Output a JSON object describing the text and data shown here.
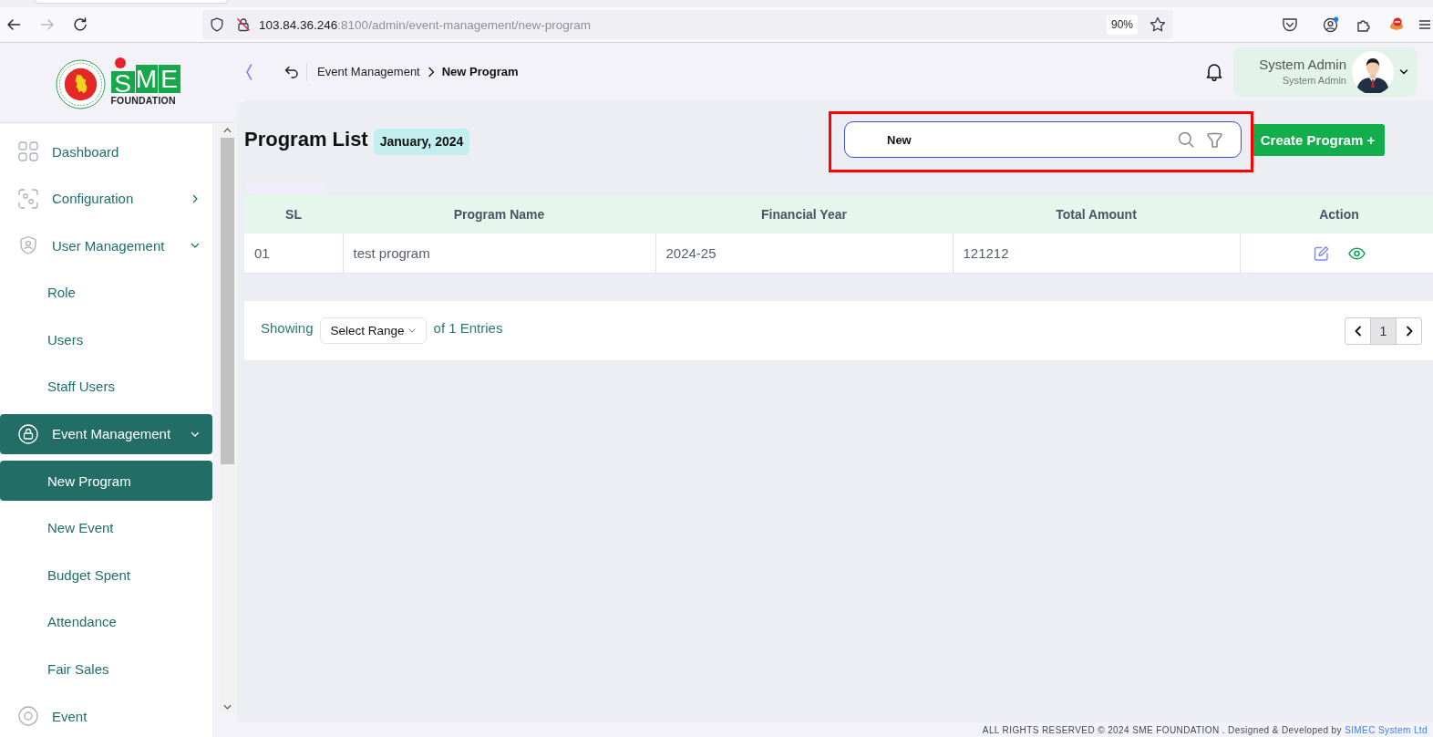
{
  "browser": {
    "back": {
      "disabled": false
    },
    "forward": {
      "disabled": true
    },
    "url": {
      "host": "103.84.36.246",
      "path": ":8100/admin/event-management/new-program"
    },
    "zoom": "90%"
  },
  "logo": {
    "letters": [
      "S",
      "M",
      "E"
    ],
    "subtitle": "FOUNDATION"
  },
  "sidebar": {
    "items": [
      {
        "label": "Dashboard",
        "kind": "link",
        "selected": false
      },
      {
        "label": "Configuration",
        "kind": "group",
        "expanded": false,
        "selected": false
      },
      {
        "label": "User Management",
        "kind": "group",
        "expanded": true,
        "selected": false,
        "children": [
          {
            "label": "Role",
            "selected": false
          },
          {
            "label": "Users",
            "selected": false
          },
          {
            "label": "Staff Users",
            "selected": false
          }
        ]
      },
      {
        "label": "Event Management",
        "kind": "group",
        "expanded": true,
        "selected": true,
        "children": [
          {
            "label": "New Program",
            "selected": true
          },
          {
            "label": "New Event",
            "selected": false
          },
          {
            "label": "Budget Spent",
            "selected": false
          },
          {
            "label": "Attendance",
            "selected": false
          },
          {
            "label": "Fair Sales",
            "selected": false
          }
        ]
      },
      {
        "label": "Event",
        "kind": "link",
        "selected": false
      }
    ]
  },
  "header": {
    "breadcrumb": [
      {
        "label": "Event Management",
        "current": false
      },
      {
        "label": "New Program",
        "current": true
      }
    ],
    "user": {
      "name": "System Admin",
      "role": "System Admin"
    }
  },
  "page": {
    "title": "Program List",
    "period": "January, 2024",
    "search": {
      "value": "New",
      "highlighted": true
    },
    "create_button": "Create Program +"
  },
  "table": {
    "columns": [
      "SL",
      "Program Name",
      "Financial Year",
      "Total Amount",
      "Action"
    ],
    "rows": [
      {
        "cells": [
          "01",
          "test program",
          "2024-25",
          "121212"
        ]
      }
    ]
  },
  "pagination": {
    "showing": "Showing",
    "range_select": "Select Range",
    "entries": "of 1 Entries",
    "pages": [
      {
        "label": "1",
        "selected": true
      }
    ]
  },
  "footer": {
    "text": "ALL RIGHTS RESERVED © 2024 SME FOUNDATION . Designed & Developed by",
    "link": "SIMEC System Ltd"
  }
}
